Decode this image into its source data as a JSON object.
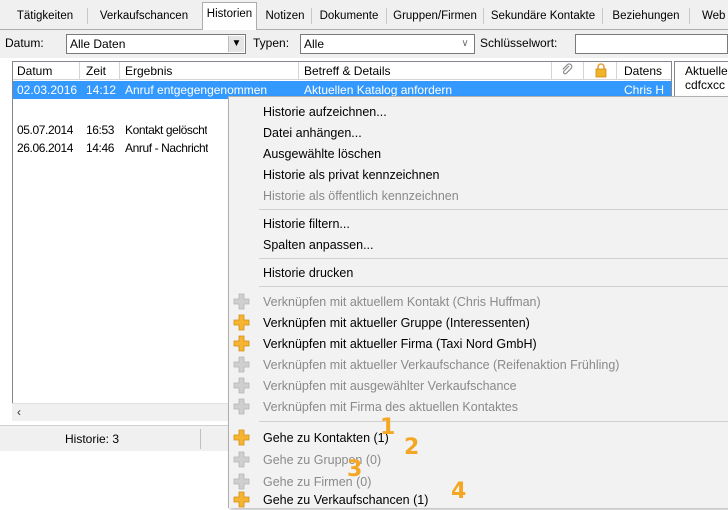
{
  "tabs": [
    {
      "label": "Tätigkeiten",
      "active": false
    },
    {
      "label": "Verkaufschancen",
      "active": false
    },
    {
      "label": "Historien",
      "active": true
    },
    {
      "label": "Notizen",
      "active": false
    },
    {
      "label": "Dokumente",
      "active": false
    },
    {
      "label": "Gruppen/Firmen",
      "active": false
    },
    {
      "label": "Sekundäre Kontakte",
      "active": false
    },
    {
      "label": "Beziehungen",
      "active": false
    },
    {
      "label": "Web",
      "active": false
    }
  ],
  "filter": {
    "date_label": "Datum:",
    "date_value": "Alle Daten",
    "type_label": "Typen:",
    "type_value": "Alle",
    "keyword_label": "Schlüsselwort:",
    "keyword_value": ""
  },
  "grid": {
    "columns": [
      "Datum",
      "Zeit",
      "Ergebnis",
      "Betreff & Details",
      "Datens"
    ],
    "rows": [
      {
        "date": "02.03.2016",
        "time": "14:12",
        "result": "Anruf entgegengenommen",
        "subject": "Aktuellen Katalog anfordern",
        "record": "Chris H",
        "selected": true
      },
      {
        "date": "05.07.2014",
        "time": "16:53",
        "result": "Kontakt gelöscht",
        "subject": "",
        "record": "",
        "selected": false
      },
      {
        "date": "26.06.2014",
        "time": "14:46",
        "result": "Anruf - Nachricht",
        "subject": "",
        "record": "",
        "selected": false
      }
    ],
    "scroll_left_glyph": "‹"
  },
  "side_panel": {
    "title": "Aktuelle",
    "line2": "cdfcxcc"
  },
  "status": {
    "text": "Historie: 3"
  },
  "menu": {
    "items": [
      {
        "label": "Historie aufzeichnen...",
        "disabled": false,
        "icon": "none"
      },
      {
        "label": "Datei anhängen...",
        "disabled": false,
        "icon": "none"
      },
      {
        "label": "Ausgewählte löschen",
        "disabled": false,
        "icon": "none"
      },
      {
        "label": "Historie als privat kennzeichnen",
        "disabled": false,
        "icon": "none"
      },
      {
        "label": "Historie als öffentlich kennzeichnen",
        "disabled": true,
        "icon": "none"
      },
      {
        "label": "Historie filtern...",
        "disabled": false,
        "icon": "none"
      },
      {
        "label": "Spalten anpassen...",
        "disabled": false,
        "icon": "none"
      },
      {
        "label": "Historie drucken",
        "disabled": false,
        "icon": "none"
      },
      {
        "label": "Verknüpfen mit aktuellem Kontakt (Chris Huffman)",
        "disabled": true,
        "icon": "plus-grey"
      },
      {
        "label": "Verknüpfen mit aktueller Gruppe (Interessenten)",
        "disabled": false,
        "icon": "plus-orange"
      },
      {
        "label": "Verknüpfen mit aktueller Firma (Taxi Nord GmbH)",
        "disabled": false,
        "icon": "plus-orange"
      },
      {
        "label": "Verknüpfen mit aktueller Verkaufschance (Reifenaktion Frühling)",
        "disabled": true,
        "icon": "plus-grey"
      },
      {
        "label": "Verknüpfen mit ausgewählter Verkaufschance",
        "disabled": true,
        "icon": "plus-grey"
      },
      {
        "label": "Verknüpfen mit Firma des aktuellen Kontaktes",
        "disabled": true,
        "icon": "plus-grey"
      },
      {
        "label": "Gehe zu Kontakten (1)",
        "disabled": false,
        "icon": "plus-orange"
      },
      {
        "label": "Gehe zu Gruppen (0)",
        "disabled": true,
        "icon": "plus-grey"
      },
      {
        "label": "Gehe zu Firmen (0)",
        "disabled": true,
        "icon": "plus-grey"
      },
      {
        "label": "Gehe zu Verkaufschancen (1)",
        "disabled": false,
        "icon": "plus-orange"
      }
    ]
  },
  "annotations": [
    "1",
    "2",
    "3",
    "4"
  ],
  "colors": {
    "selection": "#3399ff",
    "accent_orange": "#f5a623",
    "icon_grey": "#c9c9c9"
  }
}
